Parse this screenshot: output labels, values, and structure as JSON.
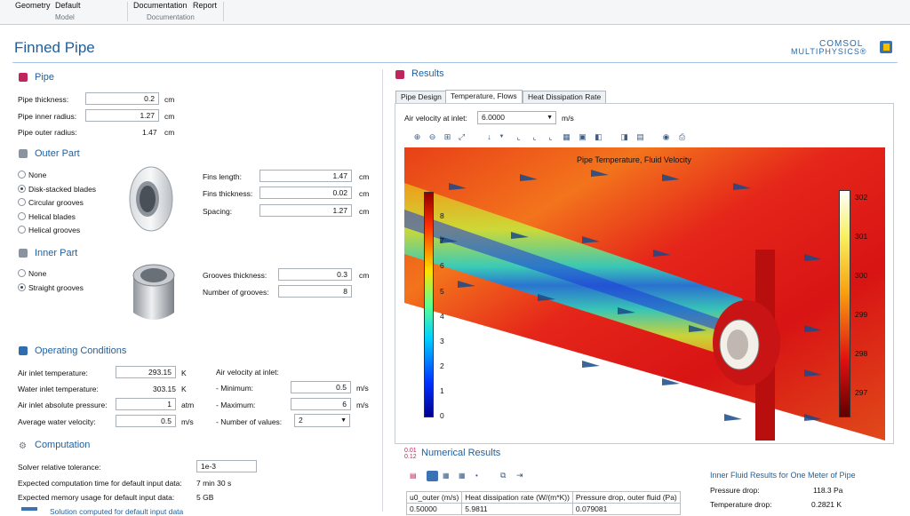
{
  "ribbon": {
    "buttons": [
      "Geometry",
      "Default",
      "Documentation",
      "Report"
    ],
    "groups": [
      "Model",
      "Documentation"
    ]
  },
  "app": {
    "title": "Finned Pipe",
    "logo_line1": "COMSOL",
    "logo_line2": "MULTIPHYSICS®"
  },
  "pipe": {
    "heading": "Pipe",
    "thickness_label": "Pipe thickness:",
    "thickness_value": "0.2",
    "thickness_unit": "cm",
    "inner_label": "Pipe inner radius:",
    "inner_value": "1.27",
    "inner_unit": "cm",
    "outer_label": "Pipe outer radius:",
    "outer_value": "1.47",
    "outer_unit": "cm"
  },
  "outer": {
    "heading": "Outer Part",
    "options": [
      "None",
      "Disk-stacked blades",
      "Circular grooves",
      "Helical blades",
      "Helical grooves"
    ],
    "selected": 1,
    "fins_length_label": "Fins length:",
    "fins_length_value": "1.47",
    "fins_length_unit": "cm",
    "fins_thickness_label": "Fins thickness:",
    "fins_thickness_value": "0.02",
    "fins_thickness_unit": "cm",
    "spacing_label": "Spacing:",
    "spacing_value": "1.27",
    "spacing_unit": "cm"
  },
  "inner": {
    "heading": "Inner Part",
    "options": [
      "None",
      "Straight grooves"
    ],
    "selected": 1,
    "grooves_thickness_label": "Grooves thickness:",
    "grooves_thickness_value": "0.3",
    "grooves_thickness_unit": "cm",
    "grooves_number_label": "Number of grooves:",
    "grooves_number_value": "8"
  },
  "operating": {
    "heading": "Operating Conditions",
    "air_temp_label": "Air inlet temperature:",
    "air_temp_value": "293.15",
    "air_temp_unit": "K",
    "water_temp_label": "Water inlet temperature:",
    "water_temp_value": "303.15",
    "water_temp_unit": "K",
    "air_pressure_label": "Air inlet absolute pressure:",
    "air_pressure_value": "1",
    "air_pressure_unit": "atm",
    "water_vel_label": "Average water velocity:",
    "water_vel_value": "0.5",
    "water_vel_unit": "m/s",
    "air_vel_heading": "Air velocity at inlet:",
    "min_label": "- Minimum:",
    "min_value": "0.5",
    "min_unit": "m/s",
    "max_label": "- Maximum:",
    "max_value": "6",
    "max_unit": "m/s",
    "num_label": "- Number of values:",
    "num_value": "2"
  },
  "computation": {
    "heading": "Computation",
    "tol_label": "Solver relative tolerance:",
    "tol_value": "1e-3",
    "time_label": "Expected computation time for default input data:",
    "time_value": "7 min 30 s",
    "mem_label": "Expected memory usage for default input data:",
    "mem_value": "5 GB",
    "status_text": "Solution computed for default input data"
  },
  "results": {
    "heading": "Results",
    "tabs": [
      "Pipe Design",
      "Temperature, Flows",
      "Heat Dissipation Rate"
    ],
    "active_tab": 1,
    "air_velocity_label": "Air velocity at inlet:",
    "air_velocity_value": "6.0000",
    "air_velocity_unit": "m/s",
    "plot_title": "Pipe Temperature, Fluid Velocity",
    "velocity_ticks": [
      "8",
      "7",
      "6",
      "5",
      "4",
      "3",
      "2",
      "1",
      "0"
    ],
    "temperature_ticks": [
      "302",
      "301",
      "300",
      "299",
      "298",
      "297"
    ],
    "toolbar_icons": [
      "zoom-in-icon",
      "zoom-out-icon",
      "zoom-box-icon",
      "zoom-extents-icon",
      "axis-icon",
      "view-xy-icon",
      "view-yz-icon",
      "view-zx-icon",
      "grid-icon",
      "transparency-icon",
      "scene-light-icon",
      "render-icon",
      "wireframe-icon",
      "camera-icon",
      "print-icon"
    ]
  },
  "numerical": {
    "heading": "Numerical Results",
    "table_headers": [
      "u0_outer (m/s)",
      "Heat dissipation rate (W/(m*K))",
      "Pressure drop, outer fluid (Pa)"
    ],
    "table_rows": [
      [
        "0.50000",
        "5.9811",
        "0.079081"
      ]
    ],
    "inner_heading": "Inner Fluid Results for One Meter of Pipe",
    "pressure_drop_label": "Pressure drop:",
    "pressure_drop_value": "118.3 Pa",
    "temperature_drop_label": "Temperature drop:",
    "temperature_drop_value": "0.2821 K"
  },
  "colors": {
    "accent": "#1e5f9e",
    "section_icon_pipe": "#c0245c",
    "section_icon_ops": "#2f6db0"
  }
}
